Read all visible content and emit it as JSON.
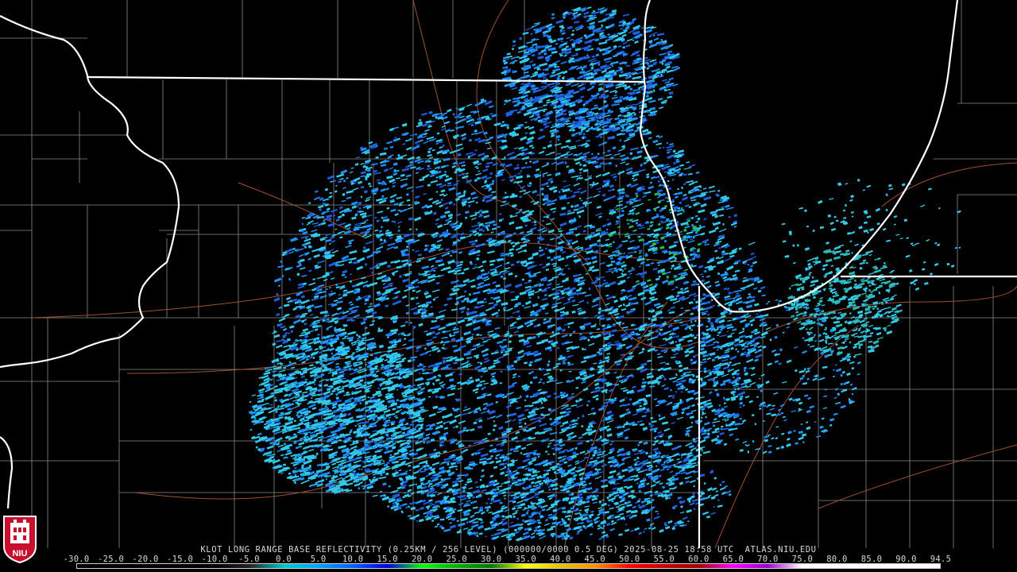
{
  "product": {
    "caption": "KLOT LONG RANGE BASE REFLECTIVITY (0.25KM / 256 LEVEL) (000000/0000 0.5 DEG) 2025-08-25 18:58 UTC  ATLAS.NIU.EDU"
  },
  "colorbar": {
    "labels": [
      "-30.0",
      "-25.0",
      "-20.0",
      "-15.0",
      "-10.0",
      "-5.0",
      "0.0",
      "5.0",
      "10.0",
      "15.0",
      "20.0",
      "25.0",
      "30.0",
      "35.0",
      "40.0",
      "45.0",
      "50.0",
      "55.0",
      "60.0",
      "65.0",
      "70.0",
      "75.0",
      "80.0",
      "85.0",
      "90.0",
      "94.5"
    ],
    "stops": [
      "#000000",
      "#000000",
      "#000000",
      "#000000",
      "#000000",
      "#222222",
      "#00c8c8",
      "#00a0ff",
      "#0060ff",
      "#0000e0",
      "#00ff00",
      "#00b000",
      "#007800",
      "#ffff00",
      "#e6c000",
      "#ff9000",
      "#ff0000",
      "#c80000",
      "#a00000",
      "#ff00ff",
      "#9900cc",
      "#ffffff",
      "#ffffff",
      "#ffffff",
      "#ffffff",
      "#ffffff"
    ]
  },
  "logo": {
    "text": "NIU",
    "color": "#c8102e"
  },
  "colors": {
    "state_border": "#ffffff",
    "county_border": "#8a8a8a",
    "highway": "#a0522d",
    "echo_light": "#33c9e8",
    "echo_mid": "#1e90ff",
    "echo_strong": "#1f5fe0",
    "echo_green": "#22c04a"
  }
}
